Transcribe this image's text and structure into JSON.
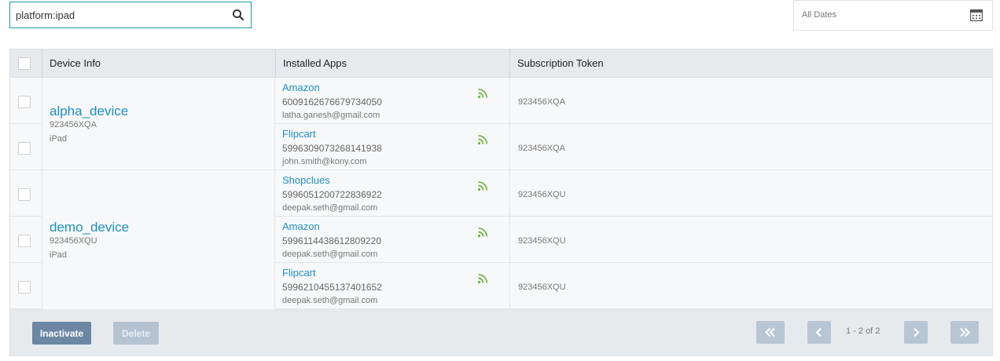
{
  "search": {
    "value": "platform:ipad",
    "icon": "search-icon"
  },
  "date_filter": {
    "label": "All Dates",
    "icon": "calendar-icon"
  },
  "table": {
    "headers": {
      "device_info": "Device Info",
      "installed_apps": "Installed Apps",
      "subscription_token": "Subscription Token"
    },
    "devices": [
      {
        "name": "alpha_device",
        "token": "923456XQA",
        "platform": "iPad"
      },
      {
        "name": "demo_device",
        "token": "923456XQU",
        "platform": "iPad"
      }
    ],
    "rows": [
      {
        "app": "Amazon",
        "id": "6009162676679734050",
        "email": "latha.ganesh@gmail.com",
        "token": "923456XQA"
      },
      {
        "app": "Flipcart",
        "id": "5996309073268141938",
        "email": "john.smith@kony.com",
        "token": "923456XQA"
      },
      {
        "app": "Shopclues",
        "id": "5996051200722836922",
        "email": "deepak.seth@gmail.com",
        "token": "923456XQU"
      },
      {
        "app": "Amazon",
        "id": "5996114438612809220",
        "email": "deepak.seth@gmail.com",
        "token": "923456XQU"
      },
      {
        "app": "Flipcart",
        "id": "5996210455137401652",
        "email": "deepak.seth@gmail.com",
        "token": "923456XQU"
      }
    ]
  },
  "footer": {
    "inactivate_label": "Inactivate",
    "delete_label": "Delete",
    "pagination": "1 - 2 of 2"
  },
  "colors": {
    "accent": "#1e8fc7",
    "rss": "#6cb33e",
    "button": "#6b87a4",
    "button_disabled": "#b6c4d2",
    "search_border": "#1a9aa8"
  }
}
